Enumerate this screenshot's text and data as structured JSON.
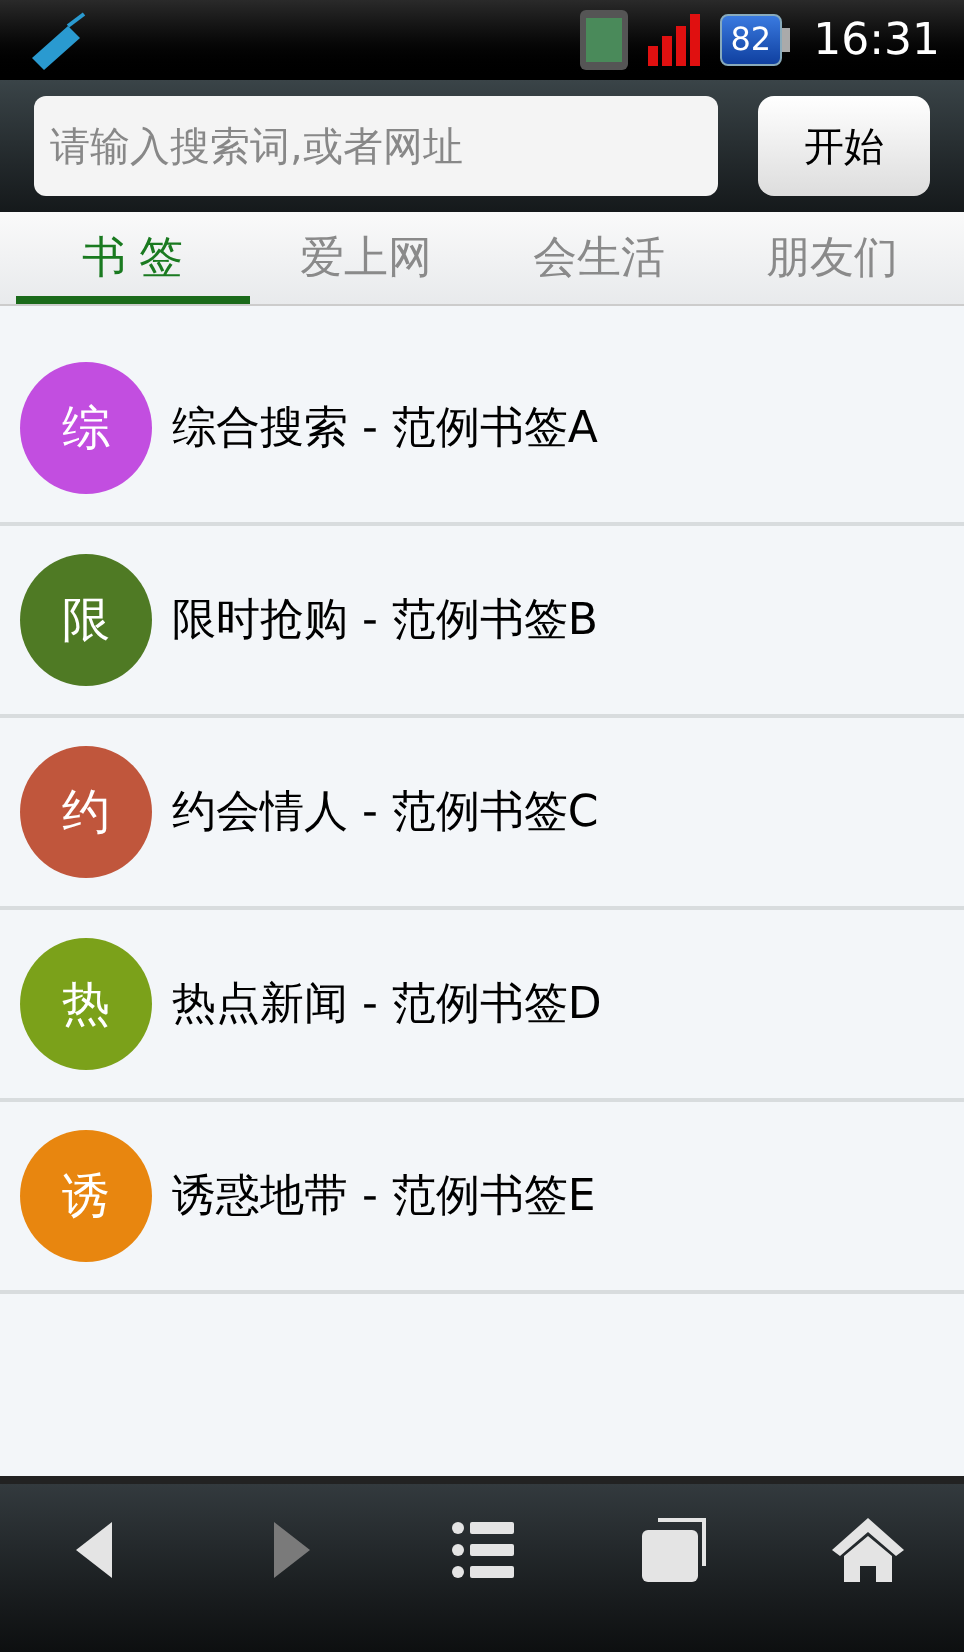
{
  "status_bar": {
    "battery": "82",
    "time": "16:31"
  },
  "search": {
    "placeholder": "请输入搜索词,或者网址",
    "button": "开始"
  },
  "tabs": [
    {
      "label": "书 签",
      "selected": true
    },
    {
      "label": "爱上网",
      "selected": false
    },
    {
      "label": "会生活",
      "selected": false
    },
    {
      "label": "朋友们",
      "selected": false
    }
  ],
  "bookmarks": [
    {
      "badge": "综",
      "title": "综合搜索 - 范例书签A",
      "color": "#c24ee0"
    },
    {
      "badge": "限",
      "title": "限时抢购 - 范例书签B",
      "color": "#4f7a24"
    },
    {
      "badge": "约",
      "title": "约会情人 - 范例书签C",
      "color": "#c0563c"
    },
    {
      "badge": "热",
      "title": "热点新闻 - 范例书签D",
      "color": "#7ba11a"
    },
    {
      "badge": "诱",
      "title": "诱惑地带 - 范例书签E",
      "color": "#e8860f"
    }
  ],
  "toolbar": [
    {
      "kind": "back",
      "disabled": false
    },
    {
      "kind": "forward",
      "disabled": true
    },
    {
      "kind": "menu",
      "disabled": false
    },
    {
      "kind": "windows",
      "disabled": false
    },
    {
      "kind": "home",
      "disabled": false
    }
  ]
}
